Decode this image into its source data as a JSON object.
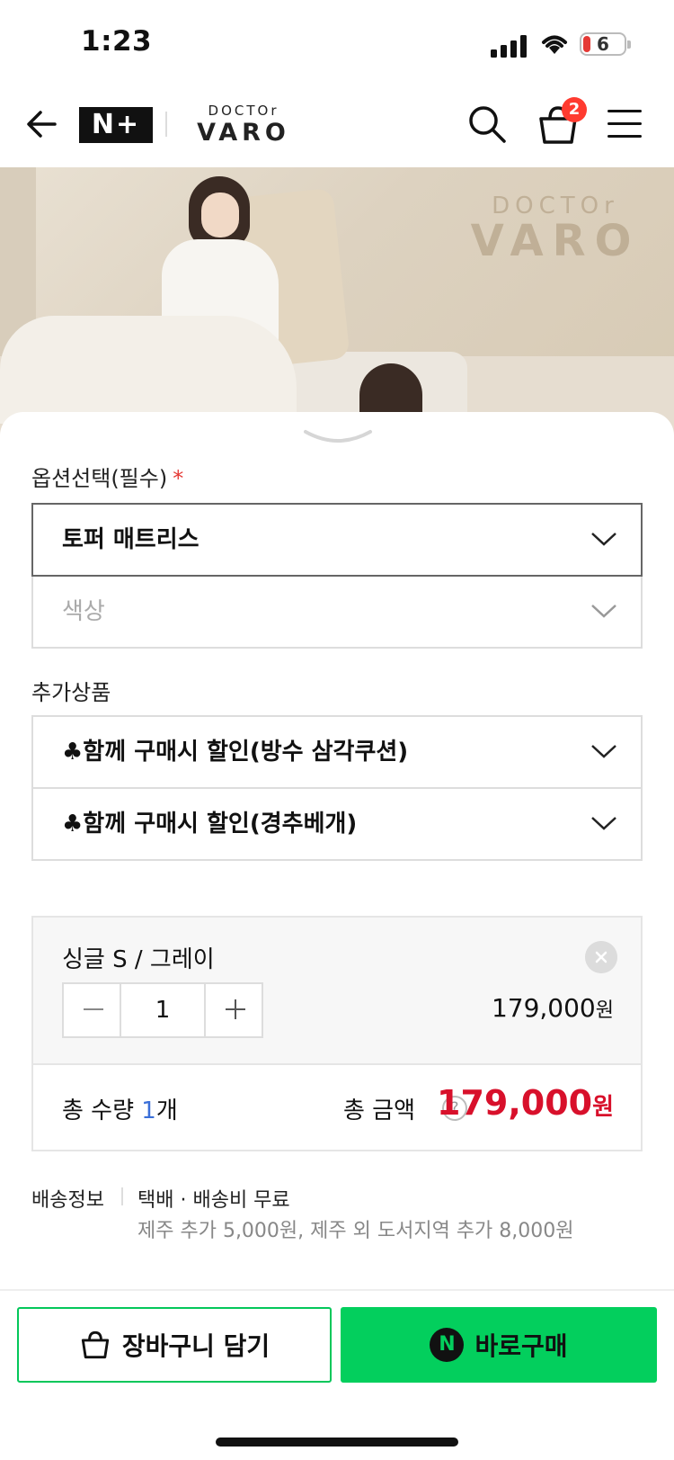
{
  "status_bar": {
    "time": "1:23",
    "battery_level": "6"
  },
  "header": {
    "np_logo": "N+",
    "brand_top": "DOCTOr",
    "brand_bottom": "VARO",
    "cart_count": "2"
  },
  "hero": {
    "brand_top": "DOCTOr",
    "brand_bottom": "VARO"
  },
  "options": {
    "label": "옵션선택(필수)",
    "required_mark": "*",
    "selects": [
      {
        "value": "토퍼 매트리스",
        "placeholder": false
      },
      {
        "value": "색상",
        "placeholder": true
      }
    ]
  },
  "addons": {
    "label": "추가상품",
    "selects": [
      {
        "value": "♣함께 구매시 할인(방수 삼각쿠션)"
      },
      {
        "value": "♣함께 구매시 할인(경추베개)"
      }
    ]
  },
  "selected_option": {
    "name": "싱글 S / 그레이",
    "quantity": "1",
    "price": "179,000",
    "price_unit": "원"
  },
  "total": {
    "qty_label": "총 수량 ",
    "qty_value": "1",
    "qty_unit": "개",
    "amount_label": "총 금액",
    "help": "?",
    "amount": "179,000",
    "amount_unit": "원"
  },
  "shipping": {
    "label": "배송정보",
    "main": "택배 · 배송비 무료",
    "sub": "제주 추가 5,000원, 제주 외 도서지역 추가 8,000원"
  },
  "actions": {
    "cart_label": "장바구니 담기",
    "buy_icon": "N",
    "buy_label": "바로구매"
  },
  "icons": {
    "back": "arrow-left-icon",
    "search": "search-icon",
    "cart": "shopping-basket-icon",
    "menu": "hamburger-menu-icon"
  },
  "colors": {
    "accent": "#03cf5d",
    "price": "#d8102b",
    "badge": "#ff3b30",
    "qty": "#3b6fd8"
  }
}
